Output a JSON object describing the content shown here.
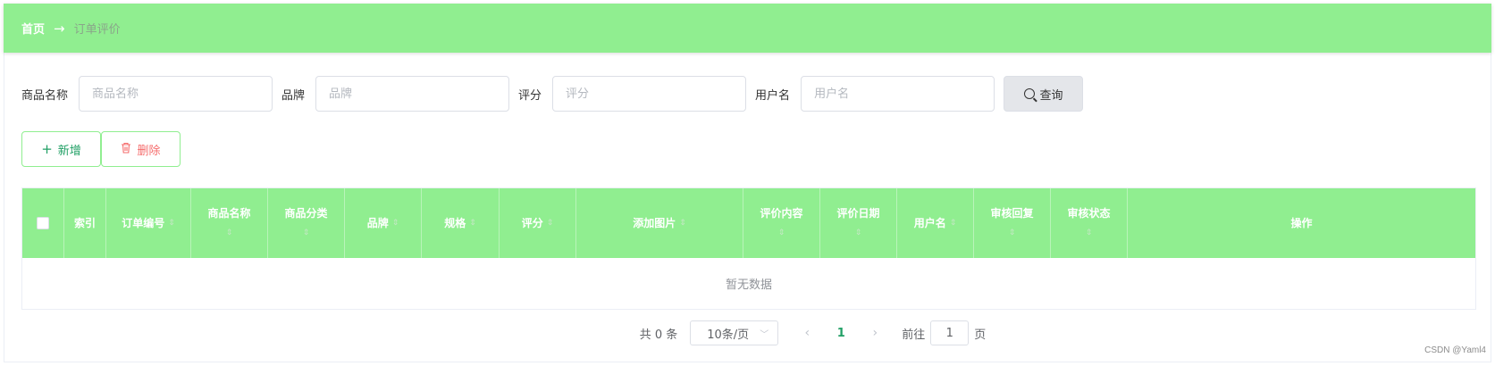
{
  "breadcrumb": {
    "home": "首页",
    "separator": "→",
    "current": "订单评价"
  },
  "search": {
    "product_name_label": "商品名称",
    "product_name_placeholder": "商品名称",
    "brand_label": "品牌",
    "brand_placeholder": "品牌",
    "rating_label": "评分",
    "rating_placeholder": "评分",
    "username_label": "用户名",
    "username_placeholder": "用户名",
    "query_label": "查询"
  },
  "actions": {
    "add_label": "新增",
    "delete_label": "删除"
  },
  "table": {
    "columns": {
      "index": "索引",
      "order_no": "订单编号",
      "product_name": "商品名称",
      "category": "商品分类",
      "brand": "品牌",
      "spec": "规格",
      "rating": "评分",
      "image": "添加图片",
      "content": "评价内容",
      "date": "评价日期",
      "username": "用户名",
      "review_reply": "审核回复",
      "review_status": "审核状态",
      "operation": "操作"
    },
    "empty_text": "暂无数据"
  },
  "pagination": {
    "total": "共 0 条",
    "page_size": "10条/页",
    "current_page": "1",
    "goto_label": "前往",
    "goto_value": "1",
    "page_suffix": "页"
  },
  "watermark": "CSDN @Yaml4",
  "colors": {
    "accent": "#90ee90",
    "link": "#22a066",
    "danger": "#f56c6c"
  }
}
